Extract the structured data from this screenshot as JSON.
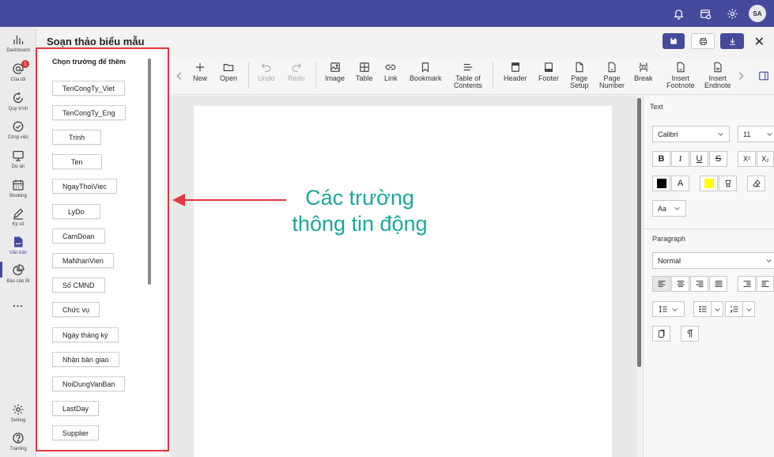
{
  "topbar": {
    "avatar_initials": "SA"
  },
  "rail": {
    "items": [
      {
        "label": "Dashboard",
        "icon": "bar-chart-icon"
      },
      {
        "label": "Của tôi",
        "icon": "at-icon",
        "badge": "1"
      },
      {
        "label": "Quy trình",
        "icon": "refresh-check-icon"
      },
      {
        "label": "Công việc",
        "icon": "task-check-icon"
      },
      {
        "label": "Dự án",
        "icon": "monitor-icon"
      },
      {
        "label": "Booking",
        "icon": "calendar-icon"
      },
      {
        "label": "Ký số",
        "icon": "pen-icon"
      },
      {
        "label": "Văn bản",
        "icon": "document-icon"
      },
      {
        "label": "Báo cáo BI",
        "icon": "pie-chart-icon"
      },
      {
        "label": "...",
        "icon": "more-icon"
      },
      {
        "label": "Setting",
        "icon": "gear-icon"
      },
      {
        "label": "Training",
        "icon": "help-icon"
      }
    ]
  },
  "page": {
    "title": "Soạn thảo biểu mẫu"
  },
  "field_panel": {
    "title": "Chọn trường để thêm",
    "fields": [
      "TenCongTy_Viet",
      "TenCongTy_Eng",
      "Trinh",
      "Ten",
      "NgayThoiViec",
      "LyDo",
      "CamDoan",
      "MaNhanVien",
      "Số CMND",
      "Chức vụ",
      "Ngày tháng ký",
      "Nhận bàn giao",
      "NoiDungVanBan",
      "LastDay",
      "Supplier"
    ]
  },
  "toolbar": {
    "new": "New",
    "open": "Open",
    "undo": "Undo",
    "redo": "Redo",
    "image": "Image",
    "table": "Table",
    "link": "Link",
    "bookmark": "Bookmark",
    "toc_1": "Table of",
    "toc_2": "Contents",
    "header": "Header",
    "footer": "Footer",
    "page_setup_1": "Page",
    "page_setup_2": "Setup",
    "page_number_1": "Page",
    "page_number_2": "Number",
    "break": "Break",
    "footnote_1": "Insert",
    "footnote_2": "Footnote",
    "endnote_1": "Insert",
    "endnote_2": "Endnote"
  },
  "annotation": {
    "line1": "Các trường",
    "line2": "thông tin động"
  },
  "right_panel": {
    "text_heading": "Text",
    "font_family": "Calibri",
    "font_size": "11",
    "bold": "B",
    "italic": "I",
    "underline": "U",
    "strike": "S",
    "superscript": "X²",
    "subscript": "X₂",
    "font_color_label": "A",
    "case_label": "Aa",
    "paragraph_heading": "Paragraph",
    "paragraph_style": "Normal",
    "font_color": "#000000",
    "highlight_color": "#ffff00"
  }
}
